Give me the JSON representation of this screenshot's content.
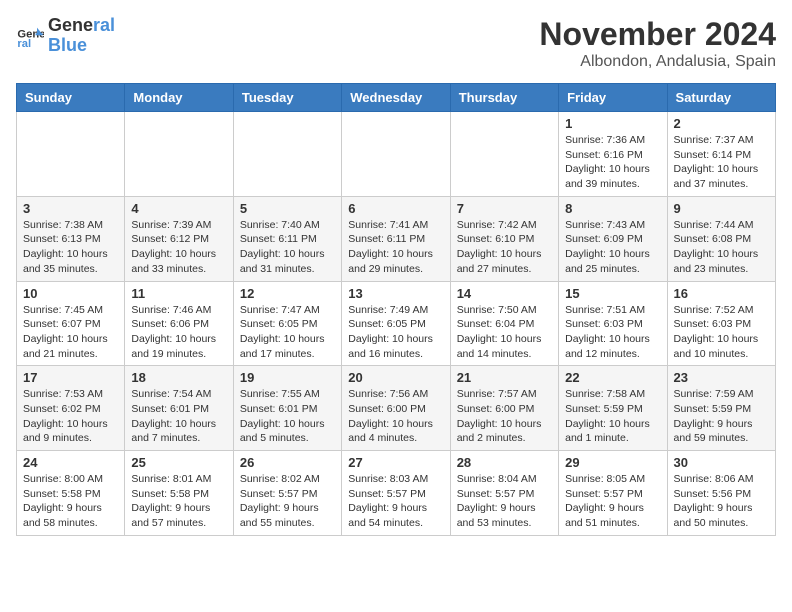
{
  "header": {
    "logo_line1": "General",
    "logo_line2": "Blue",
    "month": "November 2024",
    "location": "Albondon, Andalusia, Spain"
  },
  "columns": [
    "Sunday",
    "Monday",
    "Tuesday",
    "Wednesday",
    "Thursday",
    "Friday",
    "Saturday"
  ],
  "weeks": [
    [
      {
        "day": "",
        "info": ""
      },
      {
        "day": "",
        "info": ""
      },
      {
        "day": "",
        "info": ""
      },
      {
        "day": "",
        "info": ""
      },
      {
        "day": "",
        "info": ""
      },
      {
        "day": "1",
        "info": "Sunrise: 7:36 AM\nSunset: 6:16 PM\nDaylight: 10 hours and 39 minutes."
      },
      {
        "day": "2",
        "info": "Sunrise: 7:37 AM\nSunset: 6:14 PM\nDaylight: 10 hours and 37 minutes."
      }
    ],
    [
      {
        "day": "3",
        "info": "Sunrise: 7:38 AM\nSunset: 6:13 PM\nDaylight: 10 hours and 35 minutes."
      },
      {
        "day": "4",
        "info": "Sunrise: 7:39 AM\nSunset: 6:12 PM\nDaylight: 10 hours and 33 minutes."
      },
      {
        "day": "5",
        "info": "Sunrise: 7:40 AM\nSunset: 6:11 PM\nDaylight: 10 hours and 31 minutes."
      },
      {
        "day": "6",
        "info": "Sunrise: 7:41 AM\nSunset: 6:11 PM\nDaylight: 10 hours and 29 minutes."
      },
      {
        "day": "7",
        "info": "Sunrise: 7:42 AM\nSunset: 6:10 PM\nDaylight: 10 hours and 27 minutes."
      },
      {
        "day": "8",
        "info": "Sunrise: 7:43 AM\nSunset: 6:09 PM\nDaylight: 10 hours and 25 minutes."
      },
      {
        "day": "9",
        "info": "Sunrise: 7:44 AM\nSunset: 6:08 PM\nDaylight: 10 hours and 23 minutes."
      }
    ],
    [
      {
        "day": "10",
        "info": "Sunrise: 7:45 AM\nSunset: 6:07 PM\nDaylight: 10 hours and 21 minutes."
      },
      {
        "day": "11",
        "info": "Sunrise: 7:46 AM\nSunset: 6:06 PM\nDaylight: 10 hours and 19 minutes."
      },
      {
        "day": "12",
        "info": "Sunrise: 7:47 AM\nSunset: 6:05 PM\nDaylight: 10 hours and 17 minutes."
      },
      {
        "day": "13",
        "info": "Sunrise: 7:49 AM\nSunset: 6:05 PM\nDaylight: 10 hours and 16 minutes."
      },
      {
        "day": "14",
        "info": "Sunrise: 7:50 AM\nSunset: 6:04 PM\nDaylight: 10 hours and 14 minutes."
      },
      {
        "day": "15",
        "info": "Sunrise: 7:51 AM\nSunset: 6:03 PM\nDaylight: 10 hours and 12 minutes."
      },
      {
        "day": "16",
        "info": "Sunrise: 7:52 AM\nSunset: 6:03 PM\nDaylight: 10 hours and 10 minutes."
      }
    ],
    [
      {
        "day": "17",
        "info": "Sunrise: 7:53 AM\nSunset: 6:02 PM\nDaylight: 10 hours and 9 minutes."
      },
      {
        "day": "18",
        "info": "Sunrise: 7:54 AM\nSunset: 6:01 PM\nDaylight: 10 hours and 7 minutes."
      },
      {
        "day": "19",
        "info": "Sunrise: 7:55 AM\nSunset: 6:01 PM\nDaylight: 10 hours and 5 minutes."
      },
      {
        "day": "20",
        "info": "Sunrise: 7:56 AM\nSunset: 6:00 PM\nDaylight: 10 hours and 4 minutes."
      },
      {
        "day": "21",
        "info": "Sunrise: 7:57 AM\nSunset: 6:00 PM\nDaylight: 10 hours and 2 minutes."
      },
      {
        "day": "22",
        "info": "Sunrise: 7:58 AM\nSunset: 5:59 PM\nDaylight: 10 hours and 1 minute."
      },
      {
        "day": "23",
        "info": "Sunrise: 7:59 AM\nSunset: 5:59 PM\nDaylight: 9 hours and 59 minutes."
      }
    ],
    [
      {
        "day": "24",
        "info": "Sunrise: 8:00 AM\nSunset: 5:58 PM\nDaylight: 9 hours and 58 minutes."
      },
      {
        "day": "25",
        "info": "Sunrise: 8:01 AM\nSunset: 5:58 PM\nDaylight: 9 hours and 57 minutes."
      },
      {
        "day": "26",
        "info": "Sunrise: 8:02 AM\nSunset: 5:57 PM\nDaylight: 9 hours and 55 minutes."
      },
      {
        "day": "27",
        "info": "Sunrise: 8:03 AM\nSunset: 5:57 PM\nDaylight: 9 hours and 54 minutes."
      },
      {
        "day": "28",
        "info": "Sunrise: 8:04 AM\nSunset: 5:57 PM\nDaylight: 9 hours and 53 minutes."
      },
      {
        "day": "29",
        "info": "Sunrise: 8:05 AM\nSunset: 5:57 PM\nDaylight: 9 hours and 51 minutes."
      },
      {
        "day": "30",
        "info": "Sunrise: 8:06 AM\nSunset: 5:56 PM\nDaylight: 9 hours and 50 minutes."
      }
    ]
  ]
}
